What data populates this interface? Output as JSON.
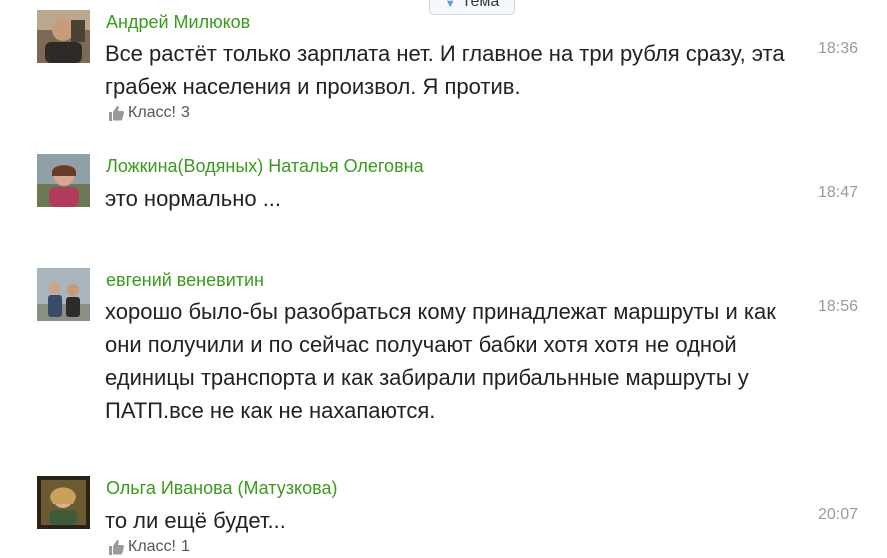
{
  "topic_tab": {
    "label": "Тема"
  },
  "comments": [
    {
      "author": "Андрей Милюков",
      "text": "Все растёт только зарплата нет. И главное на три рубля сразу, эта грабеж населения и произвол. Я против.",
      "time": "18:36",
      "like_label": "Класс!",
      "like_count": "3"
    },
    {
      "author": "Ложкина(Водяных) Наталья Олеговна",
      "text": "это нормально ...",
      "time": "18:47"
    },
    {
      "author": "евгений веневитин",
      "text": "хорошо было-бы разобраться кому принадлежат маршруты и как они получили и по сейчас получают бабки хотя хотя не одной единицы транспорта и как забирали прибальнные маршруты у ПАТП.все не как не нахапаются.",
      "time": "18:56"
    },
    {
      "author": "Ольга Иванова (Матузкова)",
      "text": "то ли ещё будет...",
      "time": "20:07",
      "like_label": "Класс!",
      "like_count": "1"
    }
  ],
  "colors": {
    "author_green": "#3b9a1e",
    "text": "#222222",
    "time_gray": "#9a9a9a"
  }
}
